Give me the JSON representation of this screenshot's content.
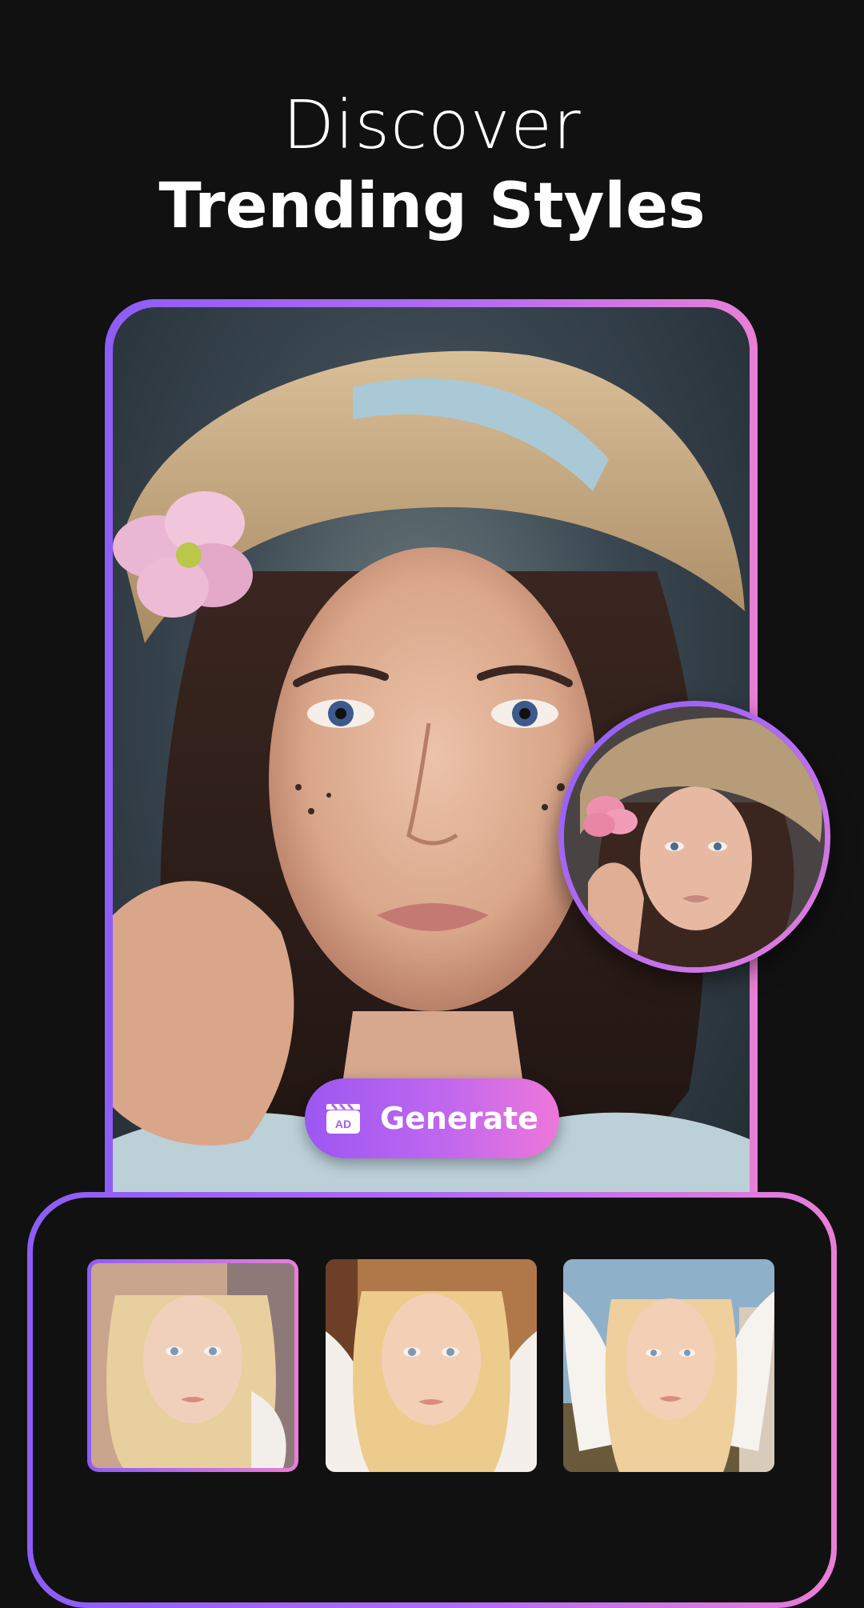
{
  "headline": {
    "line1": "Discover",
    "line2": "Trending Styles"
  },
  "main_image": {
    "description_icon": "portrait-image"
  },
  "generate_button": {
    "label": "Generate",
    "icon": "ad-clapperboard-icon",
    "icon_text": "AD"
  },
  "style_thumbnails": [
    {
      "icon": "angel-style-1",
      "selected": true
    },
    {
      "icon": "angel-style-2",
      "selected": false
    },
    {
      "icon": "angel-style-3",
      "selected": false
    }
  ],
  "colors": {
    "background": "#111112",
    "gradient_start": "#8e5cf6",
    "gradient_end": "#e97fd6"
  }
}
